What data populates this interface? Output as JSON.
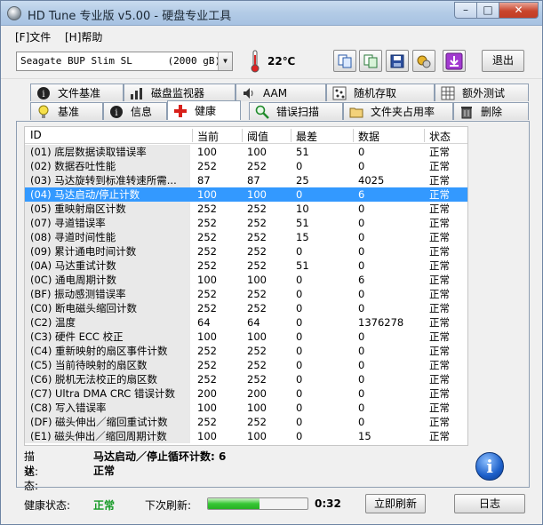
{
  "window": {
    "title": "HD Tune 专业版 v5.00 - 硬盘专业工具",
    "minimize": "–",
    "maximize": "□",
    "close": "✕"
  },
  "menu": {
    "file": "[F]文件",
    "help": "[H]帮助"
  },
  "toolbar": {
    "drive": "Seagate BUP Slim SL      (2000 gB)",
    "temperature": "22℃",
    "exit": "退出",
    "icons": [
      "copy-icon",
      "copy-all-icon",
      "save-icon",
      "options-icon",
      "download-icon"
    ]
  },
  "tabs_top": [
    {
      "label": "文件基准",
      "icon": "info-icon"
    },
    {
      "label": "磁盘监视器",
      "icon": "bar-chart-icon"
    },
    {
      "label": "AAM",
      "icon": "speaker-icon"
    },
    {
      "label": "随机存取",
      "icon": "random-dots-icon"
    },
    {
      "label": "额外测试",
      "icon": "grid-icon"
    }
  ],
  "tabs_bottom": [
    {
      "label": "基准",
      "icon": "lightbulb-icon"
    },
    {
      "label": "信息",
      "icon": "info-icon"
    },
    {
      "label": "健康",
      "icon": "red-cross-icon",
      "active": true
    },
    {
      "label": "错误扫描",
      "icon": "magnifier-icon"
    },
    {
      "label": "文件夹占用率",
      "icon": "folder-icon"
    },
    {
      "label": "删除",
      "icon": "trash-icon"
    }
  ],
  "health_table": {
    "columns": [
      "ID",
      "当前",
      "阈值",
      "最差",
      "数据",
      "状态"
    ],
    "rows": [
      {
        "id": "(01) 底层数据读取错误率",
        "current": "100",
        "threshold": "100",
        "worst": "51",
        "data": "0",
        "status": "正常"
      },
      {
        "id": "(02) 数据吞吐性能",
        "current": "252",
        "threshold": "252",
        "worst": "0",
        "data": "0",
        "status": "正常"
      },
      {
        "id": "(03) 马达旋转到标准转速所需...",
        "current": "87",
        "threshold": "87",
        "worst": "25",
        "data": "4025",
        "status": "正常"
      },
      {
        "id": "(04) 马达启动/停止计数",
        "current": "100",
        "threshold": "100",
        "worst": "0",
        "data": "6",
        "status": "正常",
        "selected": true
      },
      {
        "id": "(05) 重映射扇区计数",
        "current": "252",
        "threshold": "252",
        "worst": "10",
        "data": "0",
        "status": "正常"
      },
      {
        "id": "(07) 寻道错误率",
        "current": "252",
        "threshold": "252",
        "worst": "51",
        "data": "0",
        "status": "正常"
      },
      {
        "id": "(08) 寻道时间性能",
        "current": "252",
        "threshold": "252",
        "worst": "15",
        "data": "0",
        "status": "正常"
      },
      {
        "id": "(09) 累计通电时间计数",
        "current": "252",
        "threshold": "252",
        "worst": "0",
        "data": "0",
        "status": "正常"
      },
      {
        "id": "(0A) 马达重试计数",
        "current": "252",
        "threshold": "252",
        "worst": "51",
        "data": "0",
        "status": "正常"
      },
      {
        "id": "(0C) 通电周期计数",
        "current": "100",
        "threshold": "100",
        "worst": "0",
        "data": "6",
        "status": "正常"
      },
      {
        "id": "(BF) 振动感测错误率",
        "current": "252",
        "threshold": "252",
        "worst": "0",
        "data": "0",
        "status": "正常"
      },
      {
        "id": "(C0) 断电磁头缩回计数",
        "current": "252",
        "threshold": "252",
        "worst": "0",
        "data": "0",
        "status": "正常"
      },
      {
        "id": "(C2) 温度",
        "current": "64",
        "threshold": "64",
        "worst": "0",
        "data": "1376278",
        "status": "正常"
      },
      {
        "id": "(C3) 硬件 ECC 校正",
        "current": "100",
        "threshold": "100",
        "worst": "0",
        "data": "0",
        "status": "正常"
      },
      {
        "id": "(C4) 重新映射的扇区事件计数",
        "current": "252",
        "threshold": "252",
        "worst": "0",
        "data": "0",
        "status": "正常"
      },
      {
        "id": "(C5) 当前待映射的扇区数",
        "current": "252",
        "threshold": "252",
        "worst": "0",
        "data": "0",
        "status": "正常"
      },
      {
        "id": "(C6) 脱机无法校正的扇区数",
        "current": "252",
        "threshold": "252",
        "worst": "0",
        "data": "0",
        "status": "正常"
      },
      {
        "id": "(C7) Ultra DMA CRC 错误计数",
        "current": "200",
        "threshold": "200",
        "worst": "0",
        "data": "0",
        "status": "正常"
      },
      {
        "id": "(C8) 写入错误率",
        "current": "100",
        "threshold": "100",
        "worst": "0",
        "data": "0",
        "status": "正常"
      },
      {
        "id": "(DF) 磁头伸出／缩回重试计数",
        "current": "252",
        "threshold": "252",
        "worst": "0",
        "data": "0",
        "status": "正常"
      },
      {
        "id": "(E1) 磁头伸出／缩回周期计数",
        "current": "100",
        "threshold": "100",
        "worst": "0",
        "data": "15",
        "status": "正常"
      }
    ]
  },
  "description": {
    "desc_label": "描述:",
    "desc_value": "马达启动／停止循环计数: 6",
    "status_label": "状态:",
    "status_value": "正常"
  },
  "bottom": {
    "health_label": "健康状态:",
    "health_value": "正常",
    "next_refresh_label": "下次刷新:",
    "progress": 0.52,
    "timer": "0:32",
    "refresh_button": "立即刷新",
    "export_button": "日志"
  },
  "colors": {
    "selection": "#3399ff",
    "health_ok": "#159a25",
    "progress": "#37c735"
  }
}
